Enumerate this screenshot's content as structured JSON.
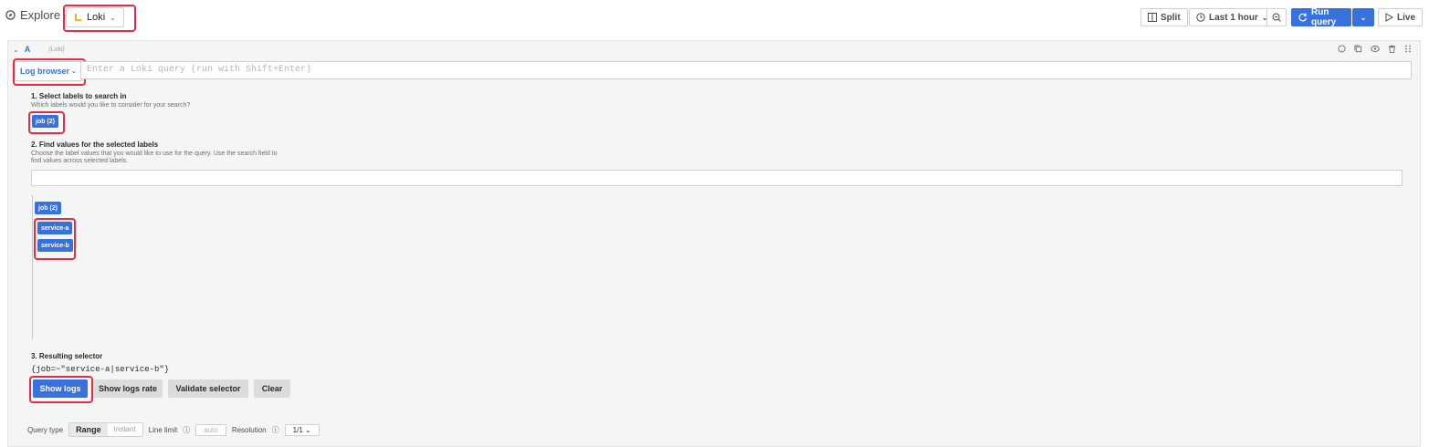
{
  "header": {
    "title": "Explore",
    "datasource": "Loki",
    "split_label": "Split",
    "time_range": "Last 1 hour",
    "run_query_label": "Run query",
    "live_label": "Live"
  },
  "query": {
    "ref_id": "A",
    "datasource_hint": "(Loki)",
    "log_browser_label": "Log browser",
    "input_placeholder": "Enter a Loki query (run with Shift+Enter)"
  },
  "step1": {
    "title": "1. Select labels to search in",
    "description": "Which labels would you like to consider for your search?",
    "labels": [
      "job (2)"
    ]
  },
  "step2": {
    "title": "2. Find values for the selected labels",
    "description_line1": "Choose the label values that you would like to use for the query. Use the search field to",
    "description_line2": "find values across selected labels.",
    "group_label": "job (2)",
    "values": [
      "service-a",
      "service-b"
    ]
  },
  "step3": {
    "title": "3. Resulting selector",
    "selector": "{job=~\"service-a|service-b\"}",
    "buttons": {
      "show_logs": "Show logs",
      "show_logs_rate": "Show logs rate",
      "validate_selector": "Validate selector",
      "clear": "Clear"
    }
  },
  "options": {
    "query_type_label": "Query type",
    "range": "Range",
    "instant": "Instant",
    "line_limit_label": "Line limit",
    "line_limit_placeholder": "auto",
    "resolution_label": "Resolution",
    "resolution_value": "1/1"
  },
  "colors": {
    "accent": "#3871dc",
    "highlight": "#e02f44"
  }
}
